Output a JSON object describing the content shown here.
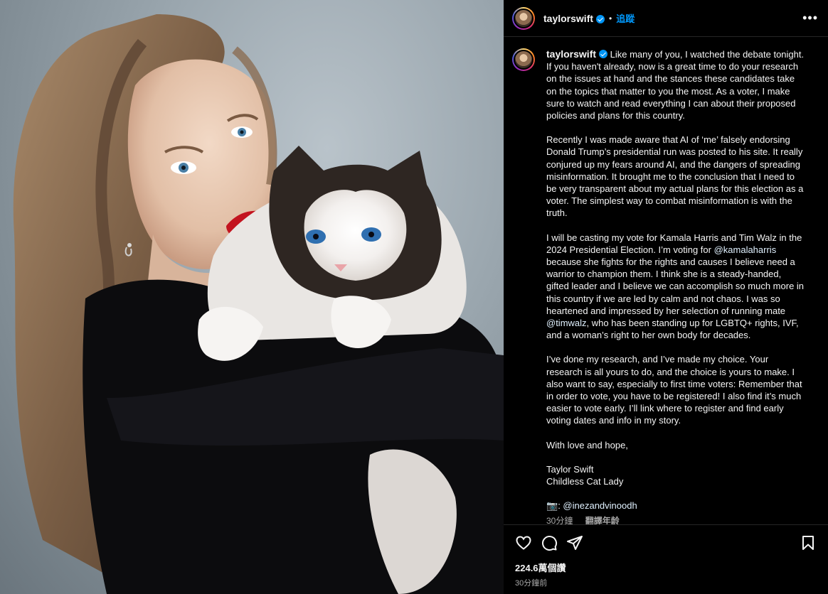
{
  "post": {
    "username": "taylorswift",
    "dot": "•",
    "follow_label": "追蹤",
    "more_label": "•••",
    "caption_paragraphs": [
      "Like many of you, I watched the debate tonight. If you haven't already, now is a great time to do your research on the issues at hand and the stances these candidates take on the topics that matter to you the most. As a voter, I make sure to watch and read everything I can about their proposed policies and plans for this country.",
      "Recently I was made aware that AI of ‘me’ falsely endorsing Donald Trump’s presidential run was posted to his site. It really conjured up my fears around AI, and the dangers of spreading misinformation. It brought me to the conclusion that I need to be very transparent about my actual plans for this election as a voter. The simplest way to combat misinformation is with the truth."
    ],
    "para3": {
      "a": "I will be casting my vote for Kamala Harris and Tim Walz in the 2024 Presidential Election. I’m voting for ",
      "mention1": "@kamalaharris",
      "b": " because she fights for the rights and causes I believe need a warrior to champion them. I think she is a steady-handed, gifted leader and I believe we can accomplish so much more in this country if we are led by calm and not chaos. I was so heartened and impressed by her selection of running mate ",
      "mention2": "@timwalz",
      "c": ", who has been standing up for LGBTQ+ rights, IVF, and a woman’s right to her own body for decades."
    },
    "para4": "I’ve done my research, and I’ve made my choice. Your research is all yours to do, and the choice is yours to make. I also want to say, especially to first time voters: Remember that in order to vote, you have to be registered! I also find it’s much easier to vote early. I’ll link where to register and find early voting dates and info in my story.",
    "para5": "With love and hope,",
    "signature_line1": "Taylor Swift",
    "signature_line2": "Childless Cat Lady",
    "credit_icon": "📷",
    "credit_prefix": ": ",
    "credit_mention": "@inezandvinoodh",
    "caption_time": "30分鐘",
    "translate_label": "翻譯年龄",
    "likes": "224.6萬個讚",
    "time_ago": "30分鐘前"
  },
  "icons": {
    "like": "heart-icon",
    "comment": "comment-icon",
    "share": "send-icon",
    "save": "bookmark-icon"
  },
  "colors": {
    "accent": "#0095f6",
    "mention": "#e0f1ff",
    "background": "#000000",
    "muted": "#a8a8a8"
  }
}
